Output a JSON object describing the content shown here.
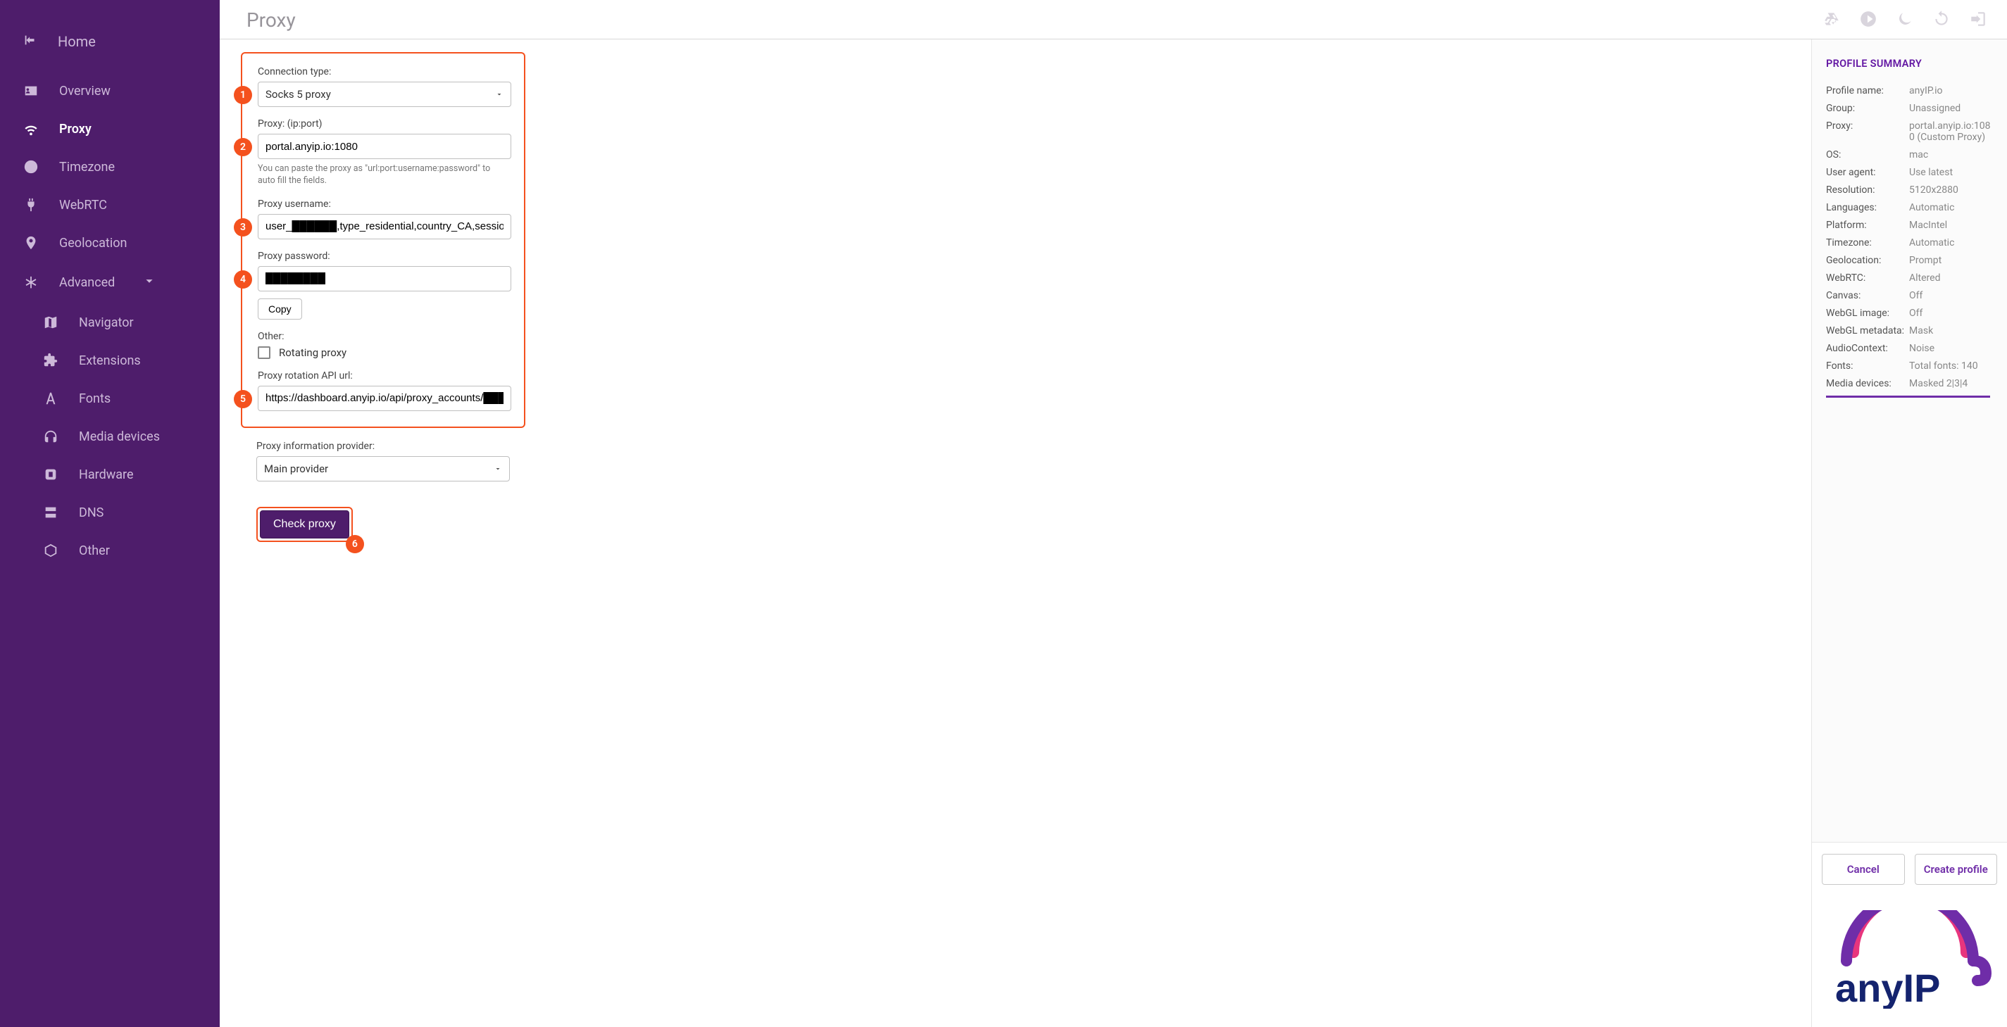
{
  "sidebar": {
    "home": "Home",
    "items": [
      {
        "label": "Overview"
      },
      {
        "label": "Proxy"
      },
      {
        "label": "Timezone"
      },
      {
        "label": "WebRTC"
      },
      {
        "label": "Geolocation"
      },
      {
        "label": "Advanced"
      }
    ],
    "advanced_children": [
      {
        "label": "Navigator"
      },
      {
        "label": "Extensions"
      },
      {
        "label": "Fonts"
      },
      {
        "label": "Media devices"
      },
      {
        "label": "Hardware"
      },
      {
        "label": "DNS"
      },
      {
        "label": "Other"
      }
    ]
  },
  "page_title": "Proxy",
  "badges": {
    "b1": "1",
    "b2": "2",
    "b3": "3",
    "b4": "4",
    "b5": "5",
    "b6": "6"
  },
  "form": {
    "connection_type_label": "Connection type:",
    "connection_type_value": "Socks 5 proxy",
    "proxy_label": "Proxy: (ip:port)",
    "proxy_value": "portal.anyip.io:1080",
    "proxy_hint": "You can paste the proxy as \"url:port:username:password\" to auto fill the fields.",
    "username_label": "Proxy username:",
    "username_value": "user_██████,type_residential,country_CA,session_██████",
    "password_label": "Proxy password:",
    "password_value": "████████",
    "copy_label": "Copy",
    "other_label": "Other:",
    "rotating_label": "Rotating proxy",
    "rotation_url_label": "Proxy rotation API url:",
    "rotation_url_value": "https://dashboard.anyip.io/api/proxy_accounts/██████",
    "provider_label": "Proxy information provider:",
    "provider_value": "Main provider",
    "check_proxy_label": "Check proxy"
  },
  "summary": {
    "title": "PROFILE SUMMARY",
    "rows": [
      {
        "k": "Profile name:",
        "v": "anyIP.io"
      },
      {
        "k": "Group:",
        "v": "Unassigned"
      },
      {
        "k": "Proxy:",
        "v": "portal.anyip.io:1080 (Custom Proxy)"
      },
      {
        "k": "OS:",
        "v": "mac"
      },
      {
        "k": "User agent:",
        "v": "Use latest"
      },
      {
        "k": "Resolution:",
        "v": "5120x2880"
      },
      {
        "k": "Languages:",
        "v": "Automatic"
      },
      {
        "k": "Platform:",
        "v": "MacIntel"
      },
      {
        "k": "Timezone:",
        "v": "Automatic"
      },
      {
        "k": "Geolocation:",
        "v": "Prompt"
      },
      {
        "k": "WebRTC:",
        "v": "Altered"
      },
      {
        "k": "Canvas:",
        "v": "Off"
      },
      {
        "k": "WebGL image:",
        "v": "Off"
      },
      {
        "k": "WebGL metadata:",
        "v": "Mask"
      },
      {
        "k": "AudioContext:",
        "v": "Noise"
      },
      {
        "k": "Fonts:",
        "v": "Total fonts: 140"
      },
      {
        "k": "Media devices:",
        "v": "Masked 2|3|4"
      }
    ],
    "cancel": "Cancel",
    "create": "Create profile"
  },
  "logo_text": "anyIP"
}
